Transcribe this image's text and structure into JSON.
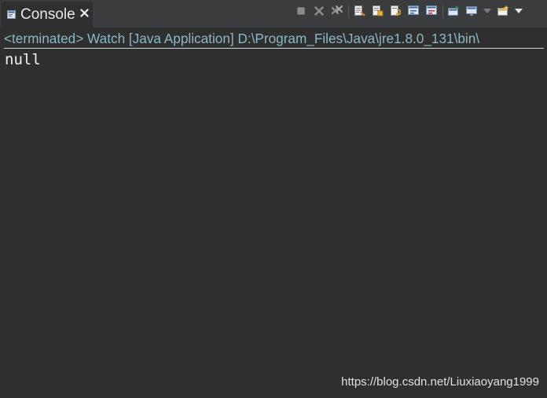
{
  "tab": {
    "label": "Console",
    "icon": "console-icon",
    "close_icon": "close-icon"
  },
  "toolbar": {
    "buttons": [
      {
        "name": "terminate-button",
        "icon": "stop-icon"
      },
      {
        "name": "remove-launch-button",
        "icon": "remove-icon"
      },
      {
        "name": "remove-all-terminated-button",
        "icon": "remove-all-icon"
      },
      {
        "name": "clear-console-button",
        "icon": "clear-console-icon"
      },
      {
        "name": "scroll-lock-button",
        "icon": "scroll-lock-icon"
      },
      {
        "name": "word-wrap-button",
        "icon": "word-wrap-icon"
      },
      {
        "name": "show-on-stdout-button",
        "icon": "stdout-icon"
      },
      {
        "name": "show-on-stderr-button",
        "icon": "stderr-icon"
      },
      {
        "name": "pin-console-button",
        "icon": "pin-icon"
      },
      {
        "name": "display-console-button",
        "icon": "monitor-icon"
      },
      {
        "name": "open-console-button",
        "icon": "new-console-icon"
      }
    ]
  },
  "console": {
    "status": "<terminated> Watch [Java Application] D:\\Program_Files\\Java\\jre1.8.0_131\\bin\\",
    "output": "null"
  },
  "watermark": "https://blog.csdn.net/Liuxiaoyang1999",
  "colors": {
    "background": "#2f2f2f",
    "tabbar": "#3b3c3d",
    "status_text": "#8ab9c6",
    "output_text": "#f2f2f2"
  }
}
